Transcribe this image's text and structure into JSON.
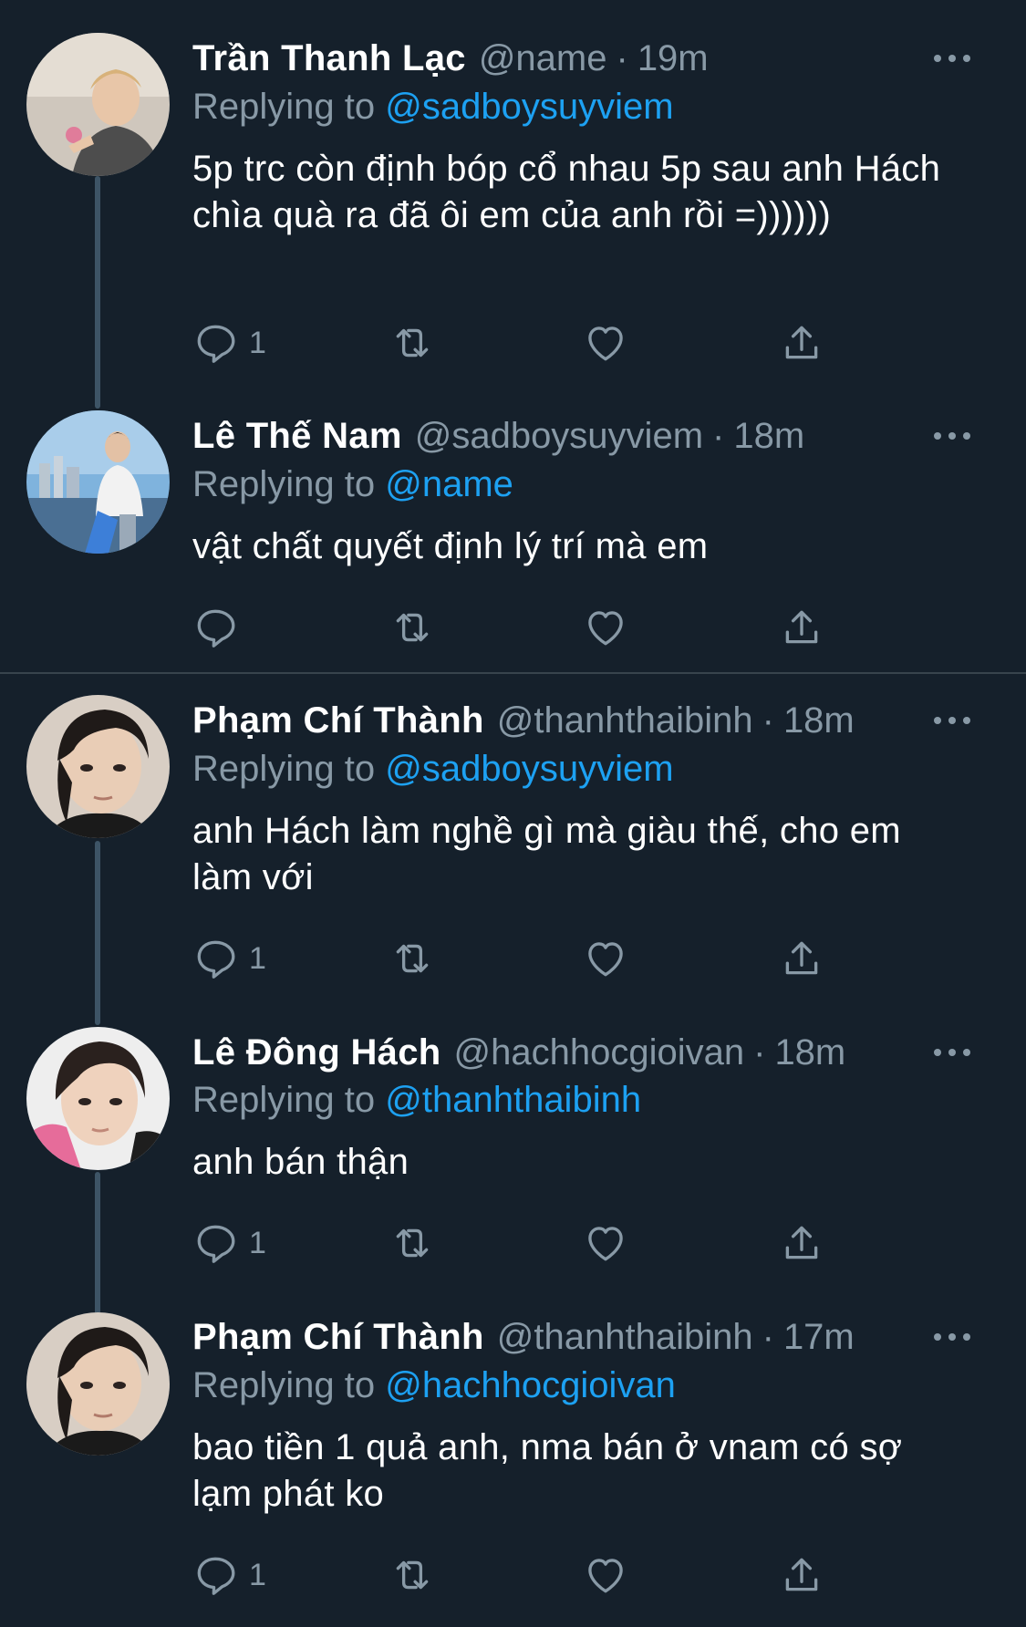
{
  "theme": {
    "background": "#15202b",
    "text_primary": "#ffffff",
    "text_secondary": "#8899a6",
    "accent": "#1da1f2",
    "thread_line": "#3d5466",
    "divider": "#38444d"
  },
  "tweets": [
    {
      "display_name": "Trần Thanh Lạc",
      "handle": "@name",
      "dot": "·",
      "time": "19m",
      "replying_prefix": "Replying to",
      "replying_to": "@sadboysuyviem",
      "text": "5p trc còn định bóp cổ nhau 5p sau anh Hách chìa quà ra đã ôi em của anh rồi =))))))",
      "reply_count": "1",
      "avatar": "avatar-photo"
    },
    {
      "display_name": "Lê Thế Nam",
      "handle": "@sadboysuyviem",
      "dot": "·",
      "time": "18m",
      "replying_prefix": "Replying to",
      "replying_to": "@name",
      "text": "vật chất quyết định lý trí mà em",
      "reply_count": "",
      "avatar": "avatar-photo"
    },
    {
      "display_name": "Phạm Chí Thành",
      "handle": "@thanhthaibinh",
      "dot": "·",
      "time": "18m",
      "replying_prefix": "Replying to",
      "replying_to": "@sadboysuyviem",
      "text": "anh Hách làm nghề gì mà giàu thế, cho em làm với",
      "reply_count": "1",
      "avatar": "avatar-photo"
    },
    {
      "display_name": "Lê Đông Hách",
      "handle": "@hachhocgioivan",
      "dot": "·",
      "time": "18m",
      "replying_prefix": "Replying to",
      "replying_to": "@thanhthaibinh",
      "text": "anh bán thận",
      "reply_count": "1",
      "avatar": "avatar-photo"
    },
    {
      "display_name": "Phạm Chí Thành",
      "handle": "@thanhthaibinh",
      "dot": "·",
      "time": "17m",
      "replying_prefix": "Replying to",
      "replying_to": "@hachhocgioivan",
      "text": "bao tiền 1 quả anh, nma bán ở vnam có sợ lạm phát ko",
      "reply_count": "1",
      "avatar": "avatar-photo"
    }
  ],
  "action_icons": [
    "reply-icon",
    "retweet-icon",
    "like-icon",
    "share-icon"
  ]
}
